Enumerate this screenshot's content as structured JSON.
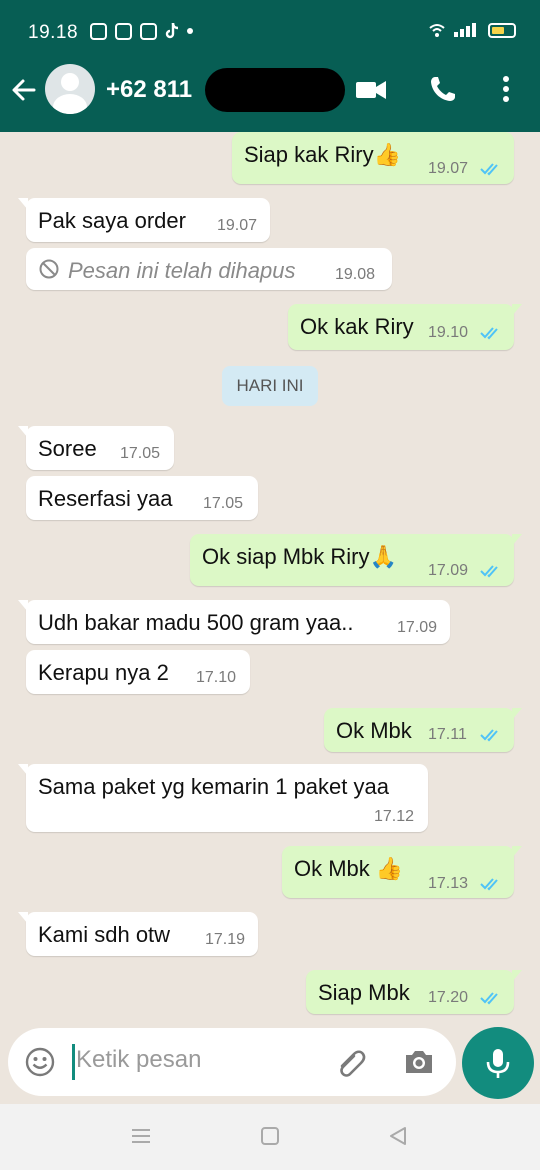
{
  "status_bar": {
    "time": "19.18",
    "icons": [
      "line-icon",
      "notification-icon",
      "app-icon",
      "tiktok-icon",
      "dot-icon",
      "wifi-icon",
      "signal-icon",
      "battery-icon"
    ]
  },
  "header": {
    "contact": "+62 811",
    "icons": [
      "back-icon",
      "video-call-icon",
      "voice-call-icon",
      "more-vert-icon"
    ]
  },
  "messages": [
    {
      "dir": "out",
      "text": "Siap kak Riry👍",
      "time": "19.07",
      "read": true
    },
    {
      "dir": "in",
      "text": "Pak saya order",
      "time": "19.07"
    },
    {
      "dir": "in",
      "text": "Pesan ini telah dihapus",
      "time": "19.08",
      "deleted": true
    },
    {
      "dir": "out",
      "text": "Ok kak Riry",
      "time": "19.10",
      "read": true
    },
    {
      "dir": "in",
      "text": "Soree",
      "time": "17.05"
    },
    {
      "dir": "in",
      "text": "Reserfasi yaa",
      "time": "17.05"
    },
    {
      "dir": "out",
      "text": "Ok siap Mbk Riry🙏",
      "time": "17.09",
      "read": true
    },
    {
      "dir": "in",
      "text": "Udh bakar madu 500 gram yaa..",
      "time": "17.09"
    },
    {
      "dir": "in",
      "text": "Kerapu nya 2",
      "time": "17.10"
    },
    {
      "dir": "out",
      "text": "Ok Mbk",
      "time": "17.11",
      "read": true
    },
    {
      "dir": "in",
      "text": "Sama paket yg kemarin 1 paket yaa",
      "time": "17.12"
    },
    {
      "dir": "out",
      "text": "Ok Mbk 👍",
      "time": "17.13",
      "read": true
    },
    {
      "dir": "in",
      "text": "Kami sdh otw",
      "time": "17.19"
    },
    {
      "dir": "out",
      "text": "Siap Mbk",
      "time": "17.20",
      "read": true
    }
  ],
  "date_separator": "HARI INI",
  "input": {
    "placeholder": "Ketik pesan"
  },
  "colors": {
    "header": "#075e54",
    "outgoing_bubble": "#dcf8c6",
    "incoming_bubble": "#ffffff",
    "accent": "#128c7e",
    "read_ticks": "#4fc3f7",
    "chat_background": "#ece5dd"
  }
}
